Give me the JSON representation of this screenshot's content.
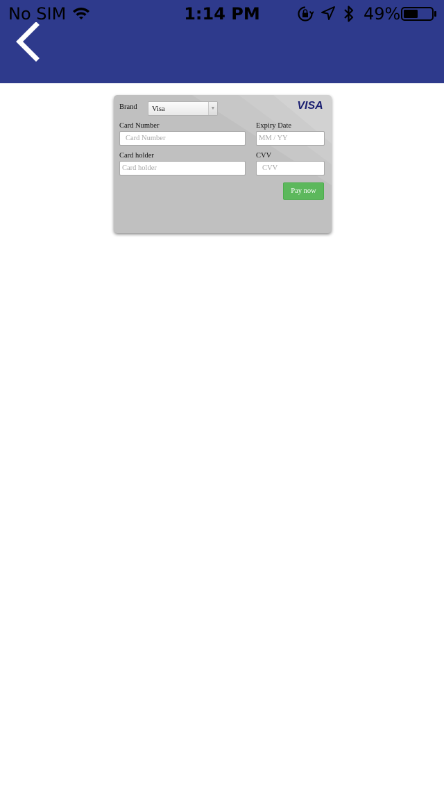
{
  "status_bar": {
    "carrier": "No SIM",
    "time": "1:14 PM",
    "battery_percent": "49%"
  },
  "nav": {
    "back_icon": "chevron-left-icon"
  },
  "card": {
    "brand_label": "Brand",
    "brand_value": "Visa",
    "logo_text": "VISA",
    "card_number_label": "Card Number",
    "card_number_placeholder": "Card Number",
    "expiry_label": "Expiry Date",
    "expiry_placeholder": "MM / YY",
    "holder_label": "Card holder",
    "holder_placeholder": "Card holder",
    "cvv_label": "CVV",
    "cvv_placeholder": "CVV",
    "pay_button_label": "Pay now"
  },
  "colors": {
    "header": "#2e3a8c",
    "card": "#c0c0c0",
    "pay_button": "#5cb85c",
    "visa_logo": "#1a1f71"
  }
}
